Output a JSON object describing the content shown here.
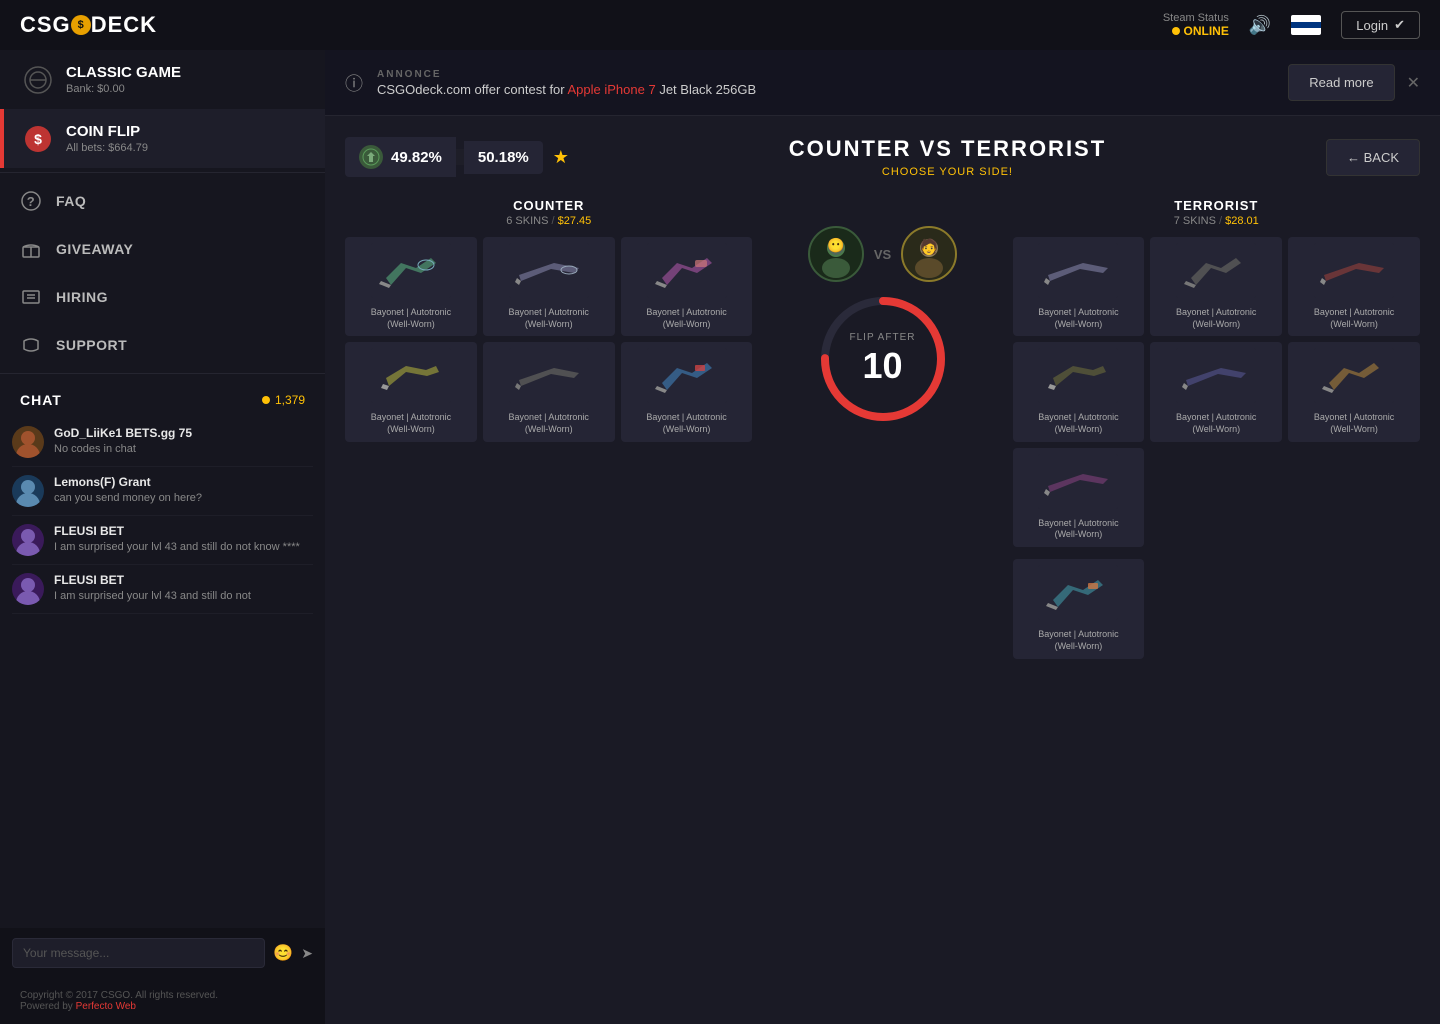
{
  "topnav": {
    "logo": "CSGODECK",
    "logo_symbol": "$",
    "steam_status_label": "Steam Status",
    "online_text": "ONLINE",
    "login_label": "Login"
  },
  "sidebar": {
    "classic_game": {
      "title": "CLASSIC GAME",
      "subtitle": "Bank: $0.00"
    },
    "coin_flip": {
      "title": "COIN FLIP",
      "subtitle": "All bets: $664.79"
    },
    "nav_items": [
      {
        "id": "faq",
        "label": "FAQ"
      },
      {
        "id": "giveaway",
        "label": "GIVEAWAY"
      },
      {
        "id": "hiring",
        "label": "HIRING"
      },
      {
        "id": "support",
        "label": "SUPPORT"
      }
    ],
    "chat": {
      "title": "CHAT",
      "count": "1,379",
      "messages": [
        {
          "username": "GoD_LiiKe1 BETS.gg 75",
          "text": "No codes in chat"
        },
        {
          "username": "Lemons(F) Grant",
          "text": "can you send money on here?"
        },
        {
          "username": "FLEUSI BET",
          "text": "I am surprised your lvl 43 and still do not know ****"
        },
        {
          "username": "FLEUSI BET",
          "text": "I am surprised your lvl 43 and still do not"
        }
      ],
      "input_placeholder": "Your message..."
    },
    "footer": {
      "copyright": "Copyright © 2017 CSGO. All rights reserved.",
      "powered_by": "Powered by ",
      "powered_link": "Perfecto Web"
    }
  },
  "announcement": {
    "label": "ANNONCE",
    "text_prefix": "CSGOdeck.com offer contest for ",
    "highlight": "Apple iPhone 7",
    "text_suffix": " Jet Black 256GB",
    "read_more": "Read more"
  },
  "game": {
    "title": "COUNTER VS TERRORIST",
    "subtitle": "CHOOSE YOUR SIDE!",
    "back_label": "← BACK",
    "ct_percent": "49.82%",
    "t_percent": "50.18%",
    "counter": {
      "label": "COUNTER",
      "skins_count": "6 SKINS",
      "price": "$27.45"
    },
    "terrorist": {
      "label": "TERRORIST",
      "skins_count": "7 SKINS",
      "price": "$28.01"
    },
    "flip_after_label": "FLIP AFTER",
    "flip_number": "10",
    "skin_name": "Bayonet | Autotronic",
    "skin_wear": "(Well-Worn)"
  }
}
